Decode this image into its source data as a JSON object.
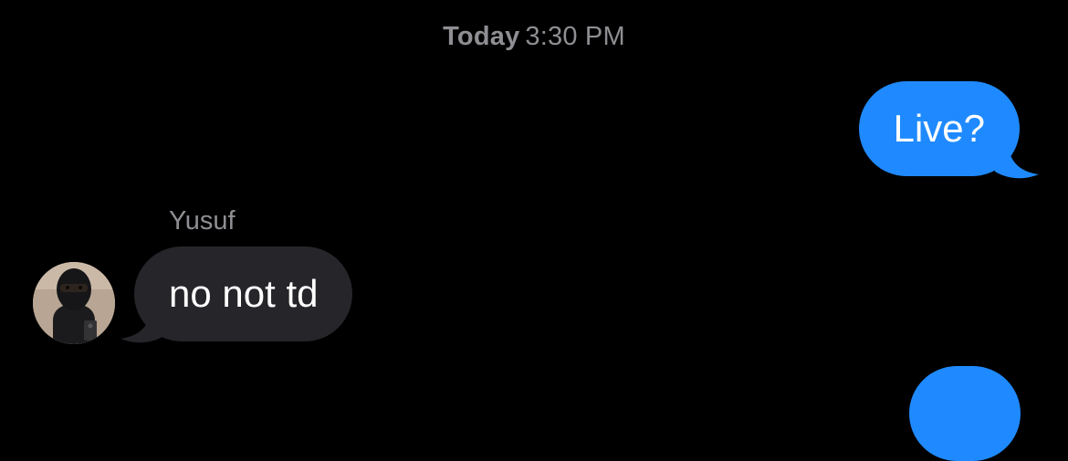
{
  "conversation": {
    "timestamp": {
      "day": "Today",
      "time": "3:30 PM"
    },
    "messages": [
      {
        "direction": "outgoing",
        "text": "Live?"
      },
      {
        "direction": "incoming",
        "sender": "Yusuf",
        "text": "no not td"
      },
      {
        "direction": "outgoing",
        "text": ""
      }
    ]
  },
  "colors": {
    "background": "#000000",
    "outgoing_bubble": "#1f8aff",
    "incoming_bubble": "#26252a",
    "meta_text": "#8e8e93",
    "message_text": "#ffffff"
  },
  "icons": {
    "avatar": "contact-avatar-icon"
  }
}
